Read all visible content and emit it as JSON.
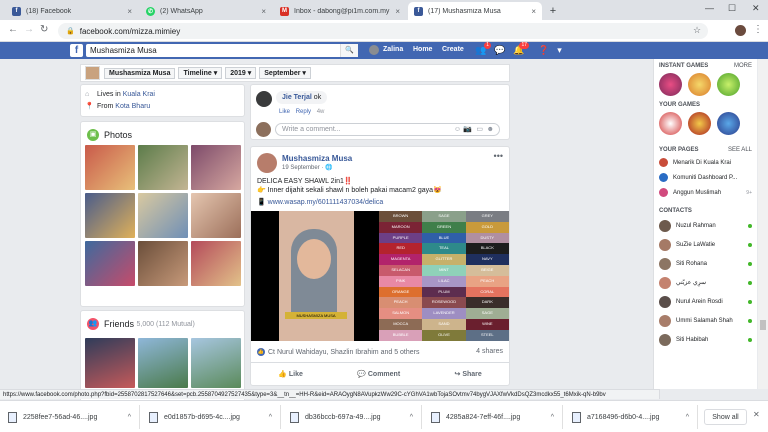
{
  "browser": {
    "tabs": [
      {
        "label": "(18) Facebook",
        "icon": "facebook-icon",
        "color": "#3b5998"
      },
      {
        "label": "(2) WhatsApp",
        "icon": "whatsapp-icon",
        "color": "#25d366"
      },
      {
        "label": "Inbox - dabong@pi1m.com.my -",
        "icon": "gmail-icon",
        "color": "#d93025"
      },
      {
        "label": "(17) Mushasmiza Musa",
        "icon": "facebook-icon",
        "color": "#3b5998"
      }
    ],
    "url": "facebook.com/mizza.mimiey",
    "status_url": "https://www.facebook.com/photo.php?fbid=2558702817527646&set=pcb.2558704927527435&type=3&__tn__=HH-R&eid=ARAOygN8AVupkzWw29C-cYGhVA1wbTojaSOvtmv74bygVJAXfwVkdDsQZ3mcdkx55_t6Mxik-qN-b9bv"
  },
  "fb": {
    "search_value": "Mushasmiza Musa",
    "user_name": "Zalina",
    "home": "Home",
    "create": "Create",
    "friend_badge": "1",
    "notif_badge": "17"
  },
  "timeline": {
    "name": "Mushasmiza Musa",
    "timeline_label": "Timeline",
    "year": "2019",
    "month": "September"
  },
  "intro": {
    "lives_prefix": "Lives in",
    "lives_place": "Kuala Krai",
    "from_prefix": "From",
    "from_place": "Kota Bharu"
  },
  "photos": {
    "title": "Photos"
  },
  "friends": {
    "title": "Friends",
    "count": "5,000 (112 Mutual)"
  },
  "comment": {
    "author": "Jie Terjal",
    "text": "ok",
    "like": "Like",
    "reply": "Reply",
    "time": "4w",
    "placeholder": "Write a comment..."
  },
  "post": {
    "author": "Mushasmiza Musa",
    "time": "19 September",
    "line1": "DELICA EASY SHAWL 2in1‼️",
    "line2": "👉 Inner dijahit sekali shawl n boleh pakai macam2 gaya😻",
    "link": "www.wasap.my/601111437034/delica",
    "video_caption": "MUSHASMIZA MUSA",
    "reactions": "Ct Nurul Wahidayu, Shazlin Ibrahim and 5 others",
    "shares": "4 shares",
    "like": "Like",
    "comment": "Comment",
    "share": "Share",
    "swatches": [
      {
        "name": "BROWN",
        "color": "#6b4f3a"
      },
      {
        "name": "SAGE",
        "color": "#8aa08a"
      },
      {
        "name": "GREY",
        "color": "#7a7d83"
      },
      {
        "name": "MAROON",
        "color": "#7b2335"
      },
      {
        "name": "GREEN",
        "color": "#3f7f4a"
      },
      {
        "name": "GOLD",
        "color": "#c99a3b"
      },
      {
        "name": "PURPLE",
        "color": "#6d3f86"
      },
      {
        "name": "BLUE",
        "color": "#2f5fa8"
      },
      {
        "name": "DUSTY",
        "color": "#b08fa1"
      },
      {
        "name": "RED",
        "color": "#b4232e"
      },
      {
        "name": "TEAL",
        "color": "#2e8a8a"
      },
      {
        "name": "BLACK",
        "color": "#1d1d1d"
      },
      {
        "name": "MAGENTA",
        "color": "#b2236b"
      },
      {
        "name": "GLITTER",
        "color": "#c6b16a"
      },
      {
        "name": "NAVY",
        "color": "#1f2f5e"
      },
      {
        "name": "SELACAN",
        "color": "#c85a6c"
      },
      {
        "name": "MINT",
        "color": "#8fd1b9"
      },
      {
        "name": "BEIGE",
        "color": "#d5bd9a"
      },
      {
        "name": "PINK",
        "color": "#e889a5"
      },
      {
        "name": "LILAC",
        "color": "#a896c6"
      },
      {
        "name": "PEACH",
        "color": "#e9a384"
      },
      {
        "name": "ORANGE",
        "color": "#dd6f2e"
      },
      {
        "name": "PLUM",
        "color": "#5d2d4f"
      },
      {
        "name": "CORAL",
        "color": "#e4735f"
      },
      {
        "name": "PEACH",
        "color": "#d88e72"
      },
      {
        "name": "ROSEWOOD",
        "color": "#8a4a4f"
      },
      {
        "name": "DARK",
        "color": "#3a2d2a"
      },
      {
        "name": "SALMON",
        "color": "#e58e82"
      },
      {
        "name": "LAVENDER",
        "color": "#9e8ec2"
      },
      {
        "name": "SAGE",
        "color": "#9fae94"
      },
      {
        "name": "MOCCA",
        "color": "#8d6b55"
      },
      {
        "name": "SAND",
        "color": "#cdb48c"
      },
      {
        "name": "WINE",
        "color": "#6a1f2e"
      },
      {
        "name": "BUBBLE",
        "color": "#d9a0b8"
      },
      {
        "name": "OLIVE",
        "color": "#7f7a3a"
      },
      {
        "name": "STEEL",
        "color": "#5d6f86"
      }
    ]
  },
  "sidebar": {
    "instant_games": "INSTANT GAMES",
    "more": "MORE",
    "your_games": "YOUR GAMES",
    "your_pages": "YOUR PAGES",
    "see_all": "SEE ALL",
    "pages": [
      {
        "name": "Menarik Di Kuala Krai",
        "count": "",
        "color": "#c94d3a"
      },
      {
        "name": "Komuniti Dashboard P...",
        "count": "",
        "color": "#2a6cc4"
      },
      {
        "name": "Anggun Muslimah",
        "count": "9+",
        "color": "#d14a7e"
      }
    ],
    "contacts_title": "CONTACTS",
    "contacts": [
      {
        "name": "Nuzul Rahman",
        "color": "#6d5a4d"
      },
      {
        "name": "SuZie LaWatie",
        "color": "#a57a66"
      },
      {
        "name": "Siti Rohana",
        "color": "#8c7563"
      },
      {
        "name": "سرِي عزيّتي",
        "color": "#c4826f"
      },
      {
        "name": "Nurul Arein Rosdi",
        "color": "#5a4e4a"
      },
      {
        "name": "Ummi Salamah Shah",
        "color": "#a87d6a"
      },
      {
        "name": "Siti Habibah",
        "color": "#7b6a5c"
      }
    ]
  },
  "downloads": {
    "files": [
      "2258fee7-56ad-46....jpg",
      "e0d1857b-d695-4c....jpg",
      "db36bccb-697a-49....jpg",
      "4285a824-7eff-46f....jpg",
      "a7168496-d6b0-4....jpg"
    ],
    "show_all": "Show all"
  }
}
